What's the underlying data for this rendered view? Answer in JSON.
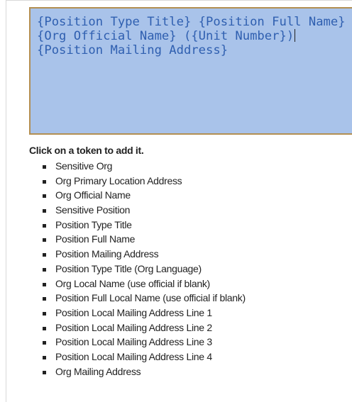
{
  "textarea": {
    "lines": [
      "{Position Type Title} {Position Full Name}",
      "{Org Official Name} ({Unit Number})",
      "{Position Mailing Address}"
    ]
  },
  "instructions": "Click on a token to add it.",
  "tokens": [
    "Sensitive Org",
    "Org Primary Location Address",
    "Org Official Name",
    "Sensitive Position",
    "Position Type Title",
    "Position Full Name",
    "Position Mailing Address",
    "Position Type Title (Org Language)",
    "Org Local Name (use official if blank)",
    "Position Full Local Name (use official if blank)",
    "Position Local Mailing Address Line 1",
    "Position Local Mailing Address Line 2",
    "Position Local Mailing Address Line 3",
    "Position Local Mailing Address Line 4",
    "Org Mailing Address"
  ],
  "colors": {
    "textarea_background": "#a9c3ea",
    "textarea_border": "#b38f52",
    "token_text": "#2f5fb0",
    "body_text": "#222222"
  }
}
